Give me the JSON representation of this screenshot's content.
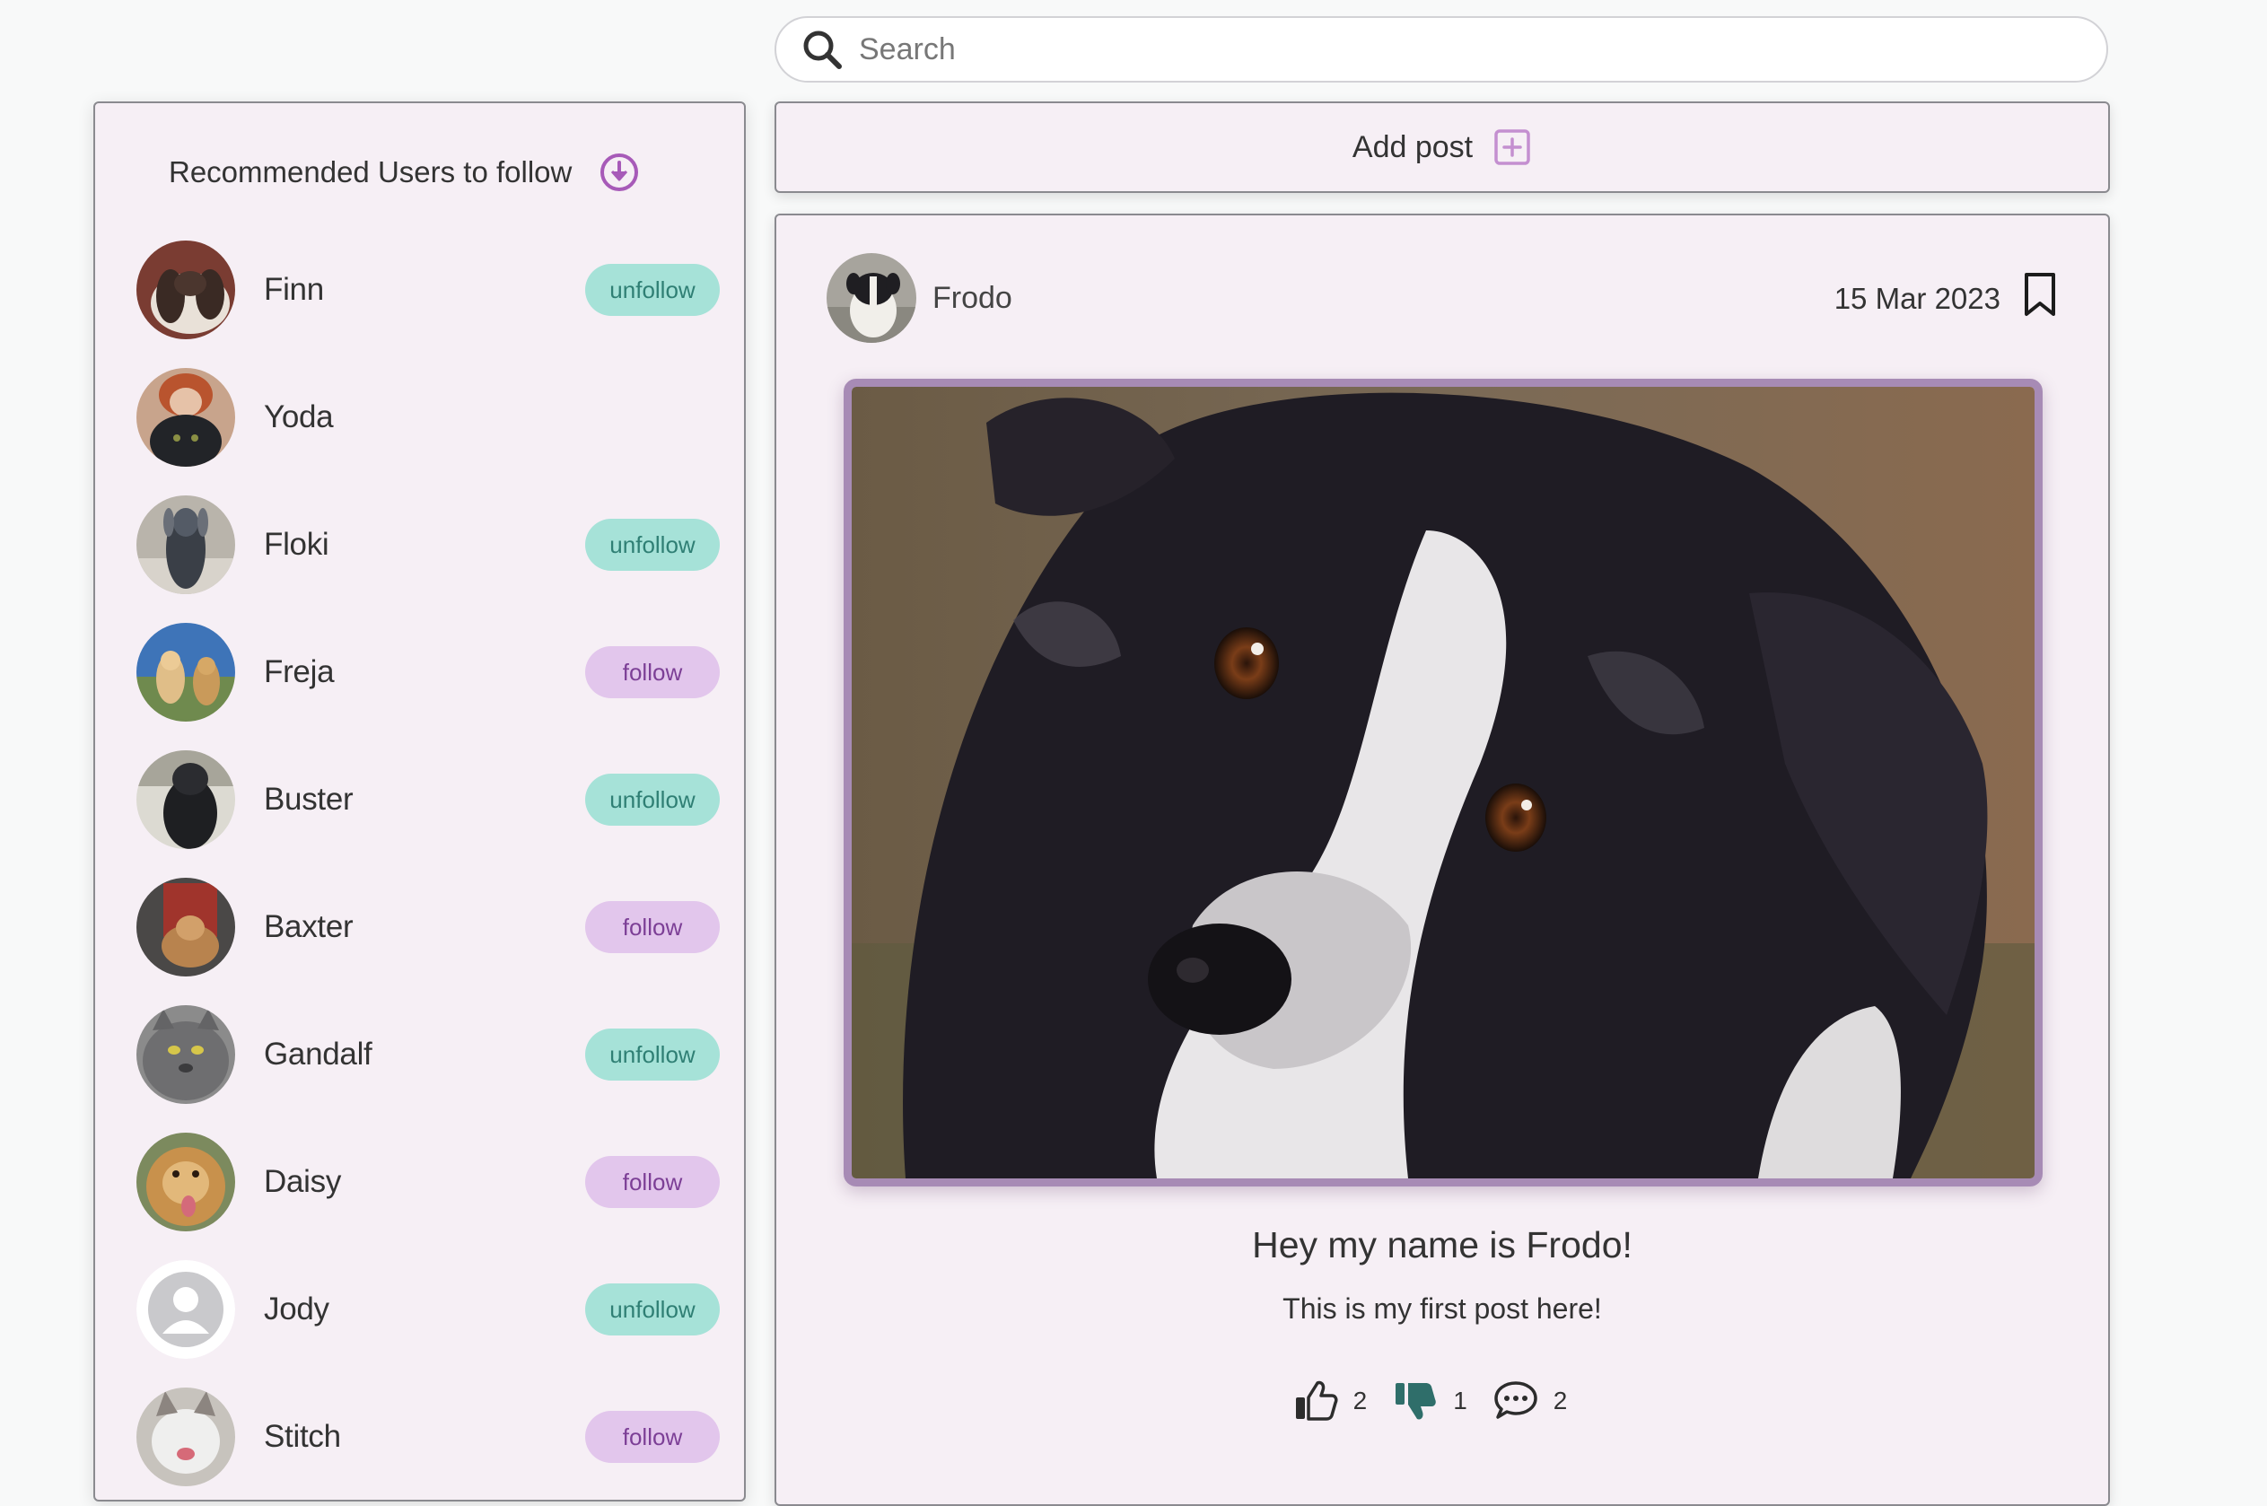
{
  "search": {
    "placeholder": "Search"
  },
  "sidebar": {
    "title": "Recommended Users to follow",
    "users": [
      {
        "name": "Finn",
        "action": "unfollow"
      },
      {
        "name": "Yoda",
        "action": ""
      },
      {
        "name": "Floki",
        "action": "unfollow"
      },
      {
        "name": "Freja",
        "action": "follow"
      },
      {
        "name": "Buster",
        "action": "unfollow"
      },
      {
        "name": "Baxter",
        "action": "follow"
      },
      {
        "name": "Gandalf",
        "action": "unfollow"
      },
      {
        "name": "Daisy",
        "action": "follow"
      },
      {
        "name": "Jody",
        "action": "unfollow"
      },
      {
        "name": "Stitch",
        "action": "follow"
      }
    ]
  },
  "add_post": {
    "label": "Add post"
  },
  "post": {
    "author": "Frodo",
    "date": "15 Mar 2023",
    "title": "Hey my name is Frodo!",
    "body": "This is my first post here!",
    "likes": "2",
    "dislikes": "1",
    "comments": "2"
  },
  "colors": {
    "unfollow_bg": "#a6e2d8",
    "follow_bg": "#e2c6ec",
    "accent": "#a75ab8",
    "image_border": "#a78bb5"
  }
}
